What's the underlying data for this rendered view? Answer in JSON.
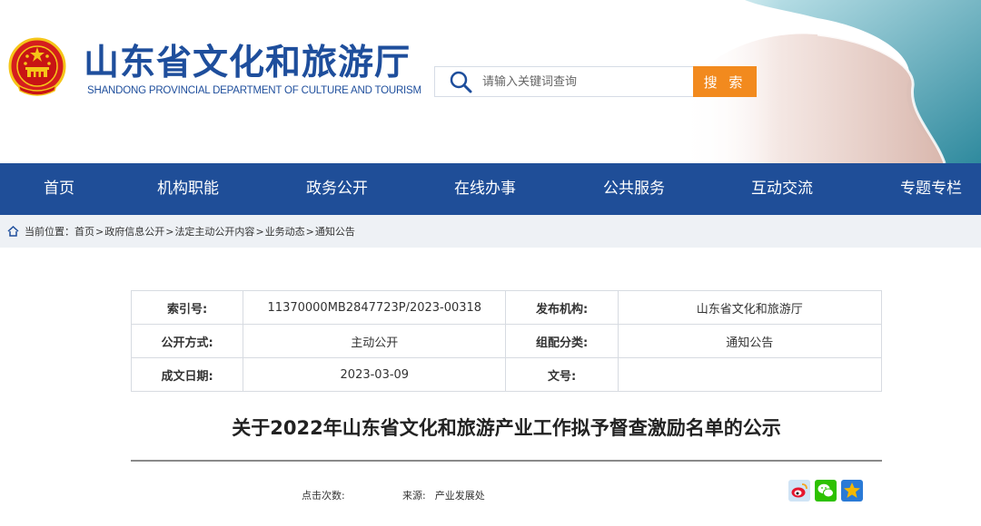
{
  "header": {
    "title": "山东省文化和旅游厅",
    "subtitle": "SHANDONG PROVINCIAL DEPARTMENT OF CULTURE AND TOURISM",
    "emblem_icon": "national-emblem-icon",
    "search": {
      "placeholder": "请输入关键词查询",
      "value": "",
      "button_label": "搜 索",
      "icon": "search-icon"
    },
    "colors": {
      "brand_blue": "#1e4e9c",
      "search_button": "#f28a1e"
    }
  },
  "nav": {
    "color": "#1f4e98",
    "items": [
      {
        "label": "首页"
      },
      {
        "label": "机构职能"
      },
      {
        "label": "政务公开"
      },
      {
        "label": "在线办事"
      },
      {
        "label": "公共服务"
      },
      {
        "label": "互动交流"
      },
      {
        "label": "专题专栏"
      }
    ]
  },
  "breadcrumb": {
    "icon": "home-icon",
    "prefix": "当前位置：",
    "items": [
      "首页",
      "政府信息公开",
      "法定主动公开内容",
      "业务动态",
      "通知公告"
    ],
    "separator": ">"
  },
  "info_table": {
    "rows": [
      {
        "label1": "索引号:",
        "value1": "11370000MB2847723P/2023-00318",
        "label2": "发布机构:",
        "value2": "山东省文化和旅游厅"
      },
      {
        "label1": "公开方式:",
        "value1": "主动公开",
        "label2": "组配分类:",
        "value2": "通知公告"
      },
      {
        "label1": "成文日期:",
        "value1": "2023-03-09",
        "label2": "文号:",
        "value2": ""
      }
    ]
  },
  "article": {
    "title": "关于2022年山东省文化和旅游产业工作拟予督查激励名单的公示",
    "clicks_label": "点击次数:",
    "clicks_value": "",
    "source_label": "来源:",
    "source_value": "产业发展处"
  },
  "share": {
    "icons": [
      "weibo-icon",
      "wechat-icon",
      "qzone-icon"
    ],
    "colors": {
      "weibo": "#e6162d",
      "wechat": "#2dc100",
      "qzone": "#f5b800"
    }
  }
}
